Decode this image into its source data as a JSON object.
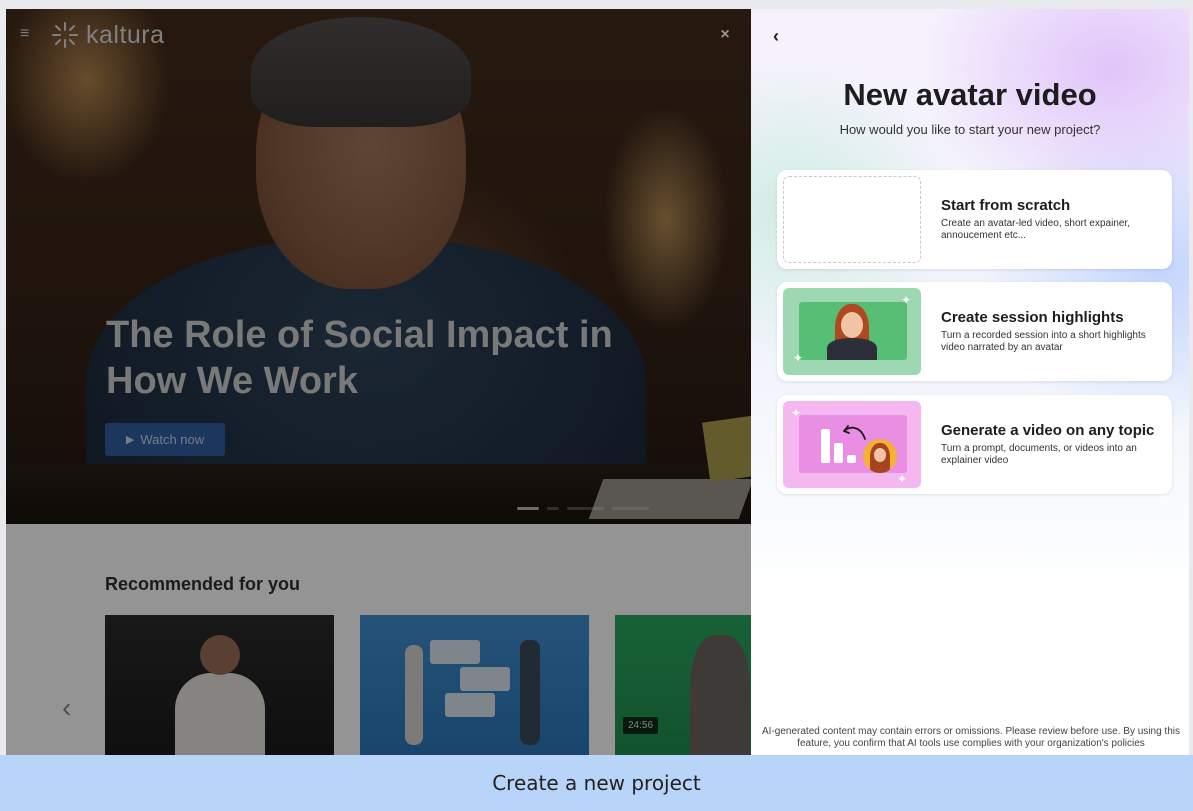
{
  "background_page": {
    "logo_text": "kaltura",
    "hero": {
      "title": "The Role of Social Impact in How We Work",
      "watch_button": "Watch now",
      "close_glyph": "×"
    },
    "recommended": {
      "title": "Recommended for you",
      "prev_glyph": "‹",
      "duration_badge": "24:56"
    }
  },
  "panel": {
    "back_glyph": "‹",
    "title": "New avatar video",
    "subtitle": "How would you like to start your new project?",
    "options": [
      {
        "title": "Start from scratch",
        "description": "Create an avatar-led video, short expainer, annoucement etc..."
      },
      {
        "title": "Create session highlights",
        "description": "Turn a recorded session into a short highlights video narrated by an avatar"
      },
      {
        "title": "Generate a video on any topic",
        "description": "Turn a prompt, documents, or videos into an explainer video"
      }
    ],
    "disclaimer": "AI-generated content may contain errors or omissions. Please review before use. By using this feature, you confirm that AI tools use complies with your organization's policies"
  },
  "caption": "Create a new project",
  "icons": {
    "menu": "hamburger-menu-icon",
    "logo": "kaltura-logo-icon",
    "close": "close-icon",
    "back": "chevron-left-icon",
    "play": "play-icon",
    "prev": "chevron-left-icon"
  },
  "colors": {
    "watch_button": "#2f5fa3",
    "caption_bar": "#b8d4f8",
    "highlights_thumb": "#9ed8b2",
    "topic_thumb": "#f5b7ef"
  }
}
